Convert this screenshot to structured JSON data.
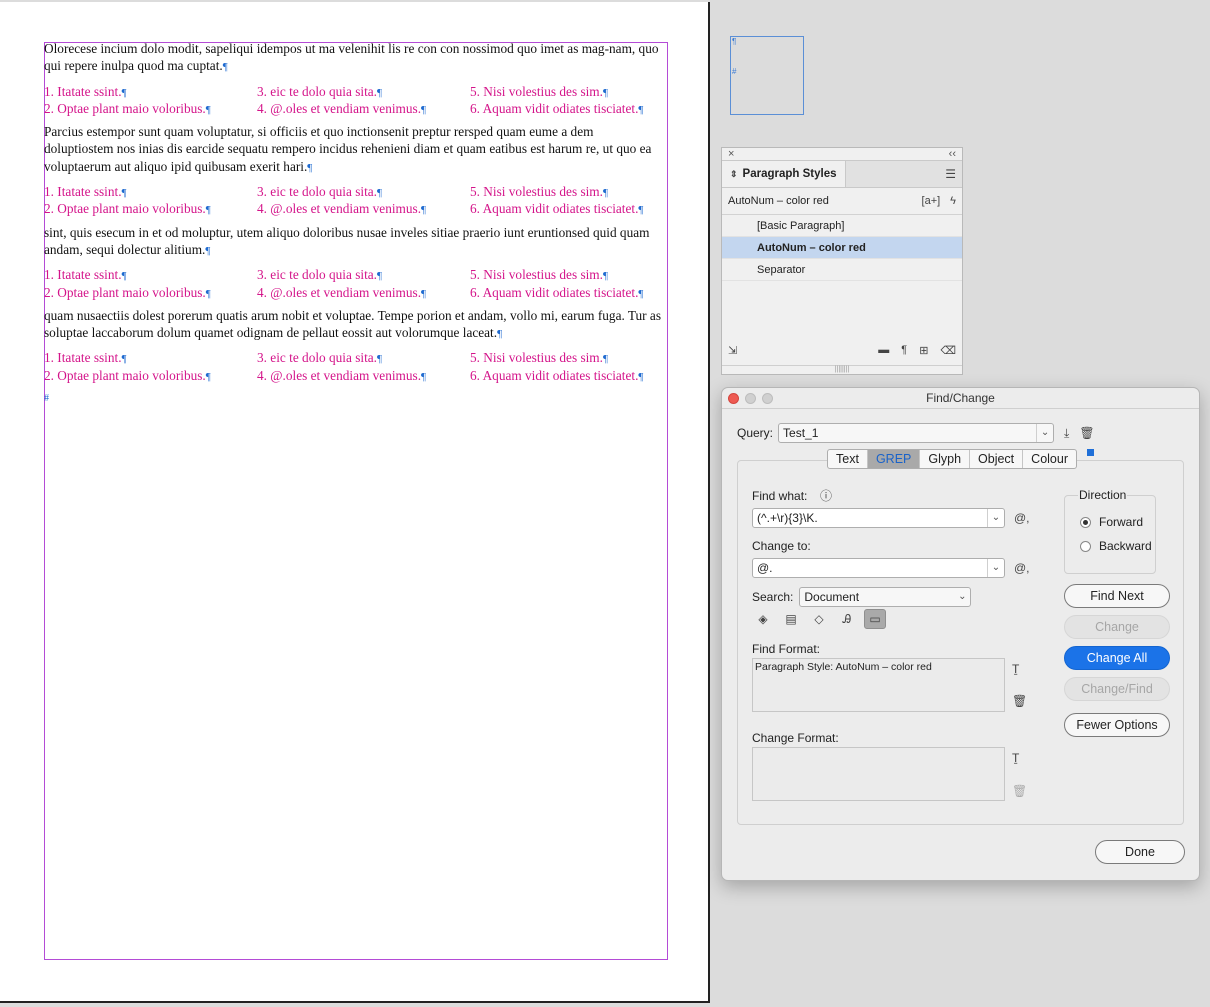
{
  "document": {
    "paragraphs": [
      "Olorecese incium dolo modit, sapeliqui idempos ut ma velenihit lis re con con nossimod quo imet as mag-nam, quo qui repere inulpa quod ma cuptat.",
      "Parcius estempor sunt quam voluptatur, si officiis et quo inctionsenit preptur rersped quam eume a dem doluptiostem nos inias dis earcide sequatu rempero incidus rehenieni diam et quam eatibus est harum re, ut quo ea voluptaerum aut aliquo ipid quibusam exerit hari.",
      "sint, quis esecum in et od moluptur, utem aliquo doloribus nusae inveles sitiae praerio iunt eruntionsed quid quam andam, sequi dolectur alitium.",
      "quam nusaectiis dolest porerum quatis arum nobit et voluptae. Tempe porion et andam, vollo mi, earum fuga. Tur as soluptae laccaborum dolum quamet odignam de pellaut eossit aut volorumque laceat."
    ],
    "list_items": [
      "1. Itatate ssint.",
      "2. Optae plant maio voloribus.",
      "3. eic te dolo quia sita.",
      "4. @.oles et vendiam venimus.",
      "5. Nisi volestius des sim.",
      "6. Aquam vidit odiates tisciatet."
    ],
    "pilcrow": "¶",
    "story_end": "#"
  },
  "paragraph_styles_panel": {
    "close_label": "×",
    "collapse_label": "‹‹",
    "tab_label": "Paragraph Styles",
    "current_style": "AutoNum – color red",
    "new_style_btn": "[a+]",
    "quick_apply": "ϟ",
    "styles": [
      "[Basic Paragraph]",
      "AutoNum – color red",
      "Separator"
    ],
    "selected_index": 1
  },
  "find_change": {
    "title": "Find/Change",
    "query_label": "Query:",
    "query_value": "Test_1",
    "tabs": [
      "Text",
      "GREP",
      "Glyph",
      "Object",
      "Colour"
    ],
    "active_tab": "GREP",
    "find_what_label": "Find what:",
    "find_what_value": "(^.+\\r){3}\\K.",
    "change_to_label": "Change to:",
    "change_to_value": "@.",
    "special_char_label": "@,",
    "search_label": "Search:",
    "search_value": "Document",
    "find_format_label": "Find Format:",
    "find_format_value": "Paragraph Style: AutoNum – color red",
    "change_format_label": "Change Format:",
    "change_format_value": "",
    "direction_label": "Direction",
    "direction_options": [
      "Forward",
      "Backward"
    ],
    "direction_selected": "Forward",
    "buttons": {
      "find_next": "Find Next",
      "change": "Change",
      "change_all": "Change All",
      "change_find": "Change/Find",
      "fewer_options": "Fewer Options",
      "done": "Done"
    }
  },
  "colors": {
    "list_text": "#d4148a",
    "frame": "#b44bd6",
    "primary_button": "#1b73e8",
    "selection": "#c3d6ef"
  }
}
